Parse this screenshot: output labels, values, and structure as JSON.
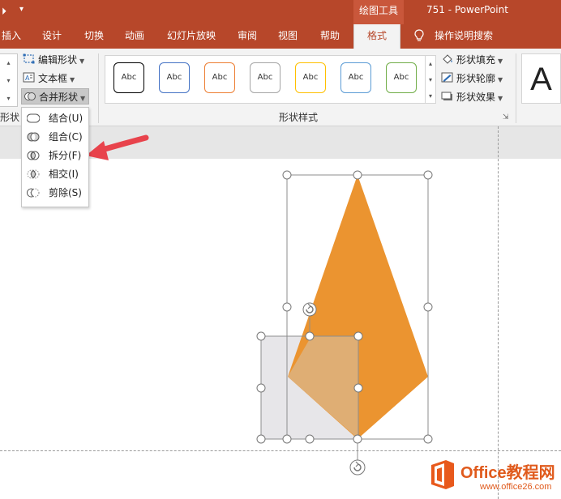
{
  "titlebar": {
    "context_group": "绘图工具",
    "window_title": "751  -  PowerPoint"
  },
  "tabs": [
    {
      "label": "插入"
    },
    {
      "label": "设计"
    },
    {
      "label": "切换"
    },
    {
      "label": "动画"
    },
    {
      "label": "幻灯片放映"
    },
    {
      "label": "审阅"
    },
    {
      "label": "视图"
    },
    {
      "label": "帮助"
    },
    {
      "label": "格式",
      "active": true
    }
  ],
  "tell_me": "操作说明搜索",
  "insert_shapes": {
    "edit_shape": "编辑形状",
    "text_box": "文本框",
    "merge_shapes": "合并形状",
    "group_label_fragment": "形状"
  },
  "shape_styles": {
    "swatch_text": "Abc",
    "swatches": [
      {
        "border": "#000000"
      },
      {
        "border": "#4472c4"
      },
      {
        "border": "#ed7d31"
      },
      {
        "border": "#a5a5a5"
      },
      {
        "border": "#ffc000"
      },
      {
        "border": "#5b9bd5"
      },
      {
        "border": "#70ad47"
      }
    ],
    "fill": "形状填充",
    "outline": "形状轮廓",
    "effects": "形状效果",
    "group_label": "形状样式"
  },
  "wordart_letter": "A",
  "merge_menu": {
    "items": [
      {
        "label": "结合(U)",
        "icon": "union-icon"
      },
      {
        "label": "组合(C)",
        "icon": "combine-icon"
      },
      {
        "label": "拆分(F)",
        "icon": "fragment-icon"
      },
      {
        "label": "相交(I)",
        "icon": "intersect-icon"
      },
      {
        "label": "剪除(S)",
        "icon": "subtract-icon"
      }
    ]
  },
  "colors": {
    "title_bar": "#b7472a",
    "kite_fill": "#eb9430",
    "overlap_fill": "#dfae74",
    "square_fill": "#e7e6e9",
    "arrow": "#e8434c"
  },
  "watermark": {
    "title": "Office教程网",
    "url": "www.office26.com"
  }
}
